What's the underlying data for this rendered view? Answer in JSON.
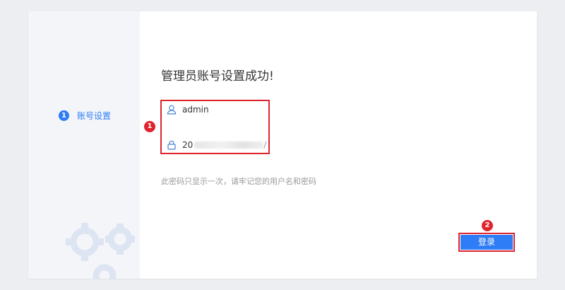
{
  "sidebar": {
    "step": {
      "number": "1",
      "label": "账号设置",
      "color": "#2e7cf6"
    }
  },
  "main": {
    "title": "管理员账号设置成功!",
    "credentials": {
      "username_icon": "user-icon",
      "username": "admin",
      "password_icon": "lock-icon",
      "password_prefix": "20",
      "password_suffix": "/"
    },
    "hint": "此密码只显示一次，请牢记您的用户名和密码",
    "login_label": "登录"
  },
  "annotations": {
    "badge_1": "1",
    "badge_2": "2",
    "highlight_color": "#e0242e"
  }
}
